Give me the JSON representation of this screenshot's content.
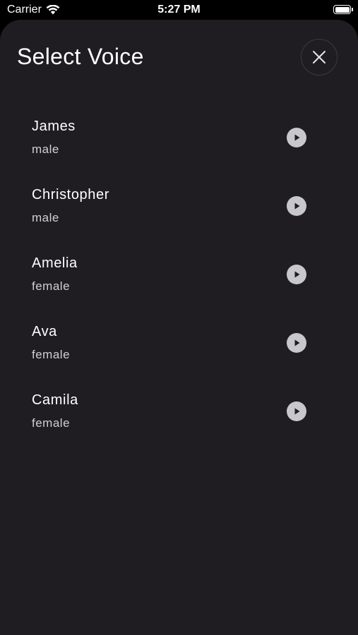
{
  "status_bar": {
    "carrier": "Carrier",
    "time": "5:27 PM"
  },
  "sheet": {
    "title": "Select Voice"
  },
  "close_icon": "close-icon",
  "play_icon": "play-icon",
  "voices": [
    {
      "name": "James",
      "gender": "male"
    },
    {
      "name": "Christopher",
      "gender": "male"
    },
    {
      "name": "Amelia",
      "gender": "female"
    },
    {
      "name": "Ava",
      "gender": "female"
    },
    {
      "name": "Camila",
      "gender": "female"
    }
  ],
  "colors": {
    "sheet_bg": "#1f1d21",
    "play_button": "#c7c7cc",
    "text": "#ffffff",
    "subtext": "#cfcfd3"
  }
}
